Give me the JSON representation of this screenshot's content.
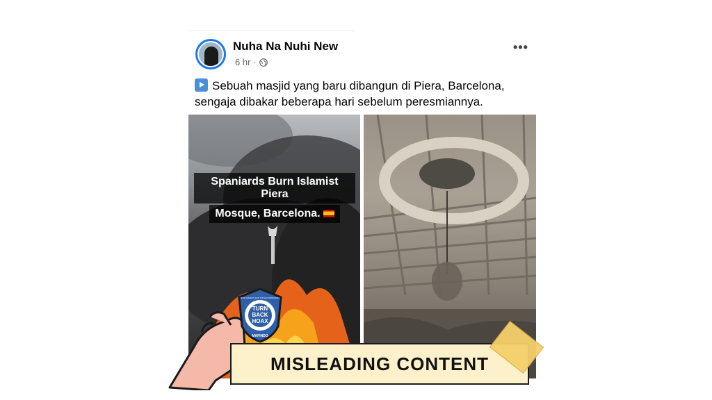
{
  "post": {
    "author": "Nuha Na Nuhi New",
    "time": "6 hr",
    "dot": "·",
    "more_label": "•••",
    "caption_line1": "Sebuah masjid yang baru dibangun di Piera, Barcelona,",
    "caption_line2": "sengaja dibakar beberapa hari sebelum peresmiannya."
  },
  "image_left": {
    "overlay_line1": "Spaniards Burn Islamist Piera",
    "overlay_line2": "Mosque, Barcelona."
  },
  "badge": {
    "line1": "TURN",
    "line2": "BACK",
    "line3": "HOAX",
    "ring_top": "MASYARAKAT ANTI FITNAH INDONESIA",
    "ring_bottom": "MAFINDO"
  },
  "label": {
    "text": "MISLEADING CONTENT"
  },
  "colors": {
    "banner_bg": "#fdf1cc",
    "badge_bg": "#2f5fa8",
    "tape": "#f5cf6b",
    "hand_skin": "#f4b9a9"
  },
  "icons": {
    "privacy": "globe-icon",
    "caption_marker": "play-button-icon",
    "more": "more-options-icon"
  }
}
